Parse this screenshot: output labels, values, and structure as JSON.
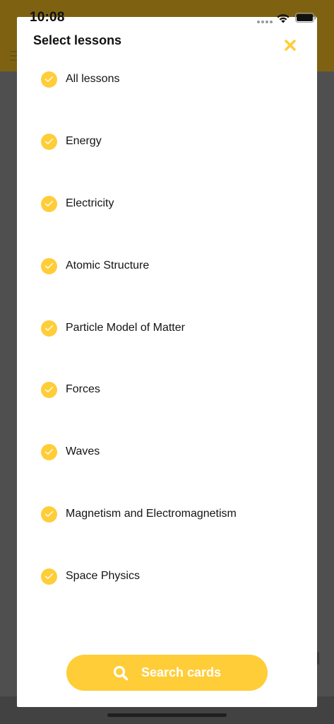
{
  "status_bar": {
    "time": "10:08"
  },
  "modal": {
    "title": "Select lessons",
    "close_icon": "close-icon",
    "lessons": [
      {
        "label": "All lessons",
        "checked": true
      },
      {
        "label": "Energy",
        "checked": true
      },
      {
        "label": "Electricity",
        "checked": true
      },
      {
        "label": "Atomic Structure",
        "checked": true
      },
      {
        "label": "Particle Model of Matter",
        "checked": true
      },
      {
        "label": "Forces",
        "checked": true
      },
      {
        "label": "Waves",
        "checked": true
      },
      {
        "label": "Magnetism and Electromagnetism",
        "checked": true
      },
      {
        "label": "Space Physics",
        "checked": true
      }
    ],
    "search_button": {
      "label": "Search cards",
      "icon": "search-icon"
    }
  },
  "colors": {
    "accent": "#ffcd38",
    "overlay": "#4f4f4f",
    "header_dimmed": "#7e6212"
  }
}
